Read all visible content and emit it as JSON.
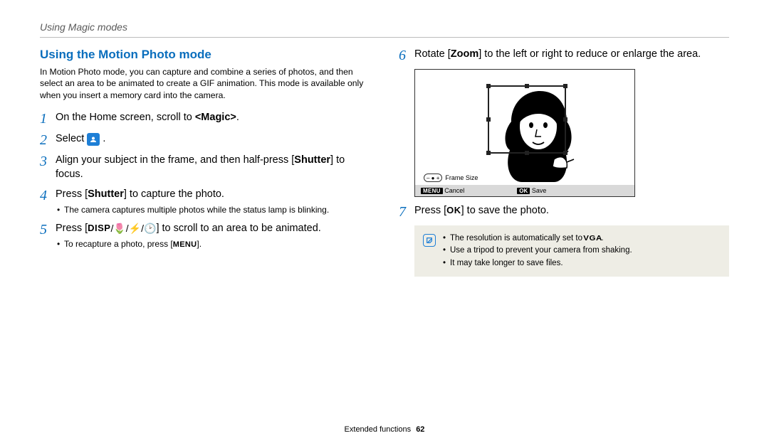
{
  "breadcrumb": "Using Magic modes",
  "section_title": "Using the Motion Photo mode",
  "intro": "In Motion Photo mode, you can capture and combine a series of photos, and then select an area to be animated to create a GIF animation. This mode is available only when you insert a memory card into the camera.",
  "steps": {
    "s1": {
      "pre": "On the Home screen, scroll to ",
      "bold": "<Magic>",
      "post": "."
    },
    "s2": {
      "pre": "Select ",
      "post": " ."
    },
    "s3": {
      "pre": "Align your subject in the frame, and then half-press [",
      "bold": "Shutter",
      "post": "] to focus."
    },
    "s4": {
      "pre": "Press [",
      "bold": "Shutter",
      "post": "] to capture the photo."
    },
    "s4_sub": "The camera captures multiple photos while the status lamp is blinking.",
    "s5": {
      "pre": "Press [",
      "post": "] to scroll to an area to be animated."
    },
    "s5_sub_pre": "To recapture a photo, press [",
    "s5_sub_post": "].",
    "s6": {
      "pre": "Rotate [",
      "bold": "Zoom",
      "post": "] to the left or right to reduce or enlarge the area."
    },
    "s7": {
      "pre": "Press [",
      "post": "] to save the photo."
    }
  },
  "screen": {
    "frame_size": "Frame Size",
    "cancel": "Cancel",
    "save": "Save",
    "menu": "MENU",
    "ok": "OK"
  },
  "notes": {
    "n1_pre": "The resolution is automatically set to ",
    "n1_vga": "VGA",
    "n1_post": ".",
    "n2": "Use a tripod to prevent your camera from shaking.",
    "n3": "It may take longer to save files."
  },
  "key_labels": {
    "disp": "DISP",
    "menu": "MENU",
    "ok": "OK"
  },
  "footer": {
    "section": "Extended functions",
    "page": "62"
  }
}
